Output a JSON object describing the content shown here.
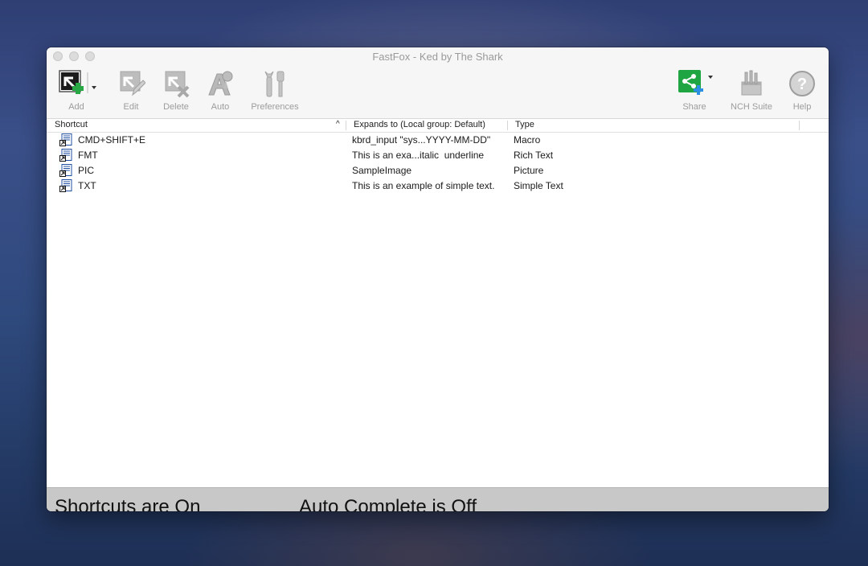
{
  "window": {
    "title": "FastFox - Ked by The Shark"
  },
  "toolbar": {
    "add": "Add",
    "edit": "Edit",
    "delete": "Delete",
    "auto": "Auto",
    "preferences": "Preferences",
    "share": "Share",
    "nch_suite": "NCH Suite",
    "help": "Help"
  },
  "table": {
    "columns": [
      "Shortcut",
      "Expands to (Local group: Default)",
      "Type"
    ],
    "rows": [
      {
        "shortcut": "CMD+SHIFT+E",
        "expands": "kbrd_input \"sys...YYYY-MM-DD\"",
        "type": "Macro"
      },
      {
        "shortcut": "FMT",
        "expands": "This is an exa...italic  underline",
        "type": "Rich Text"
      },
      {
        "shortcut": "PIC",
        "expands": "SampleImage",
        "type": "Picture"
      },
      {
        "shortcut": "TXT",
        "expands": "This is an example of simple text.",
        "type": "Simple Text"
      }
    ]
  },
  "status": {
    "shortcuts": "Shortcuts are On",
    "autocomplete": "Auto Complete is Off"
  },
  "colors": {
    "accent_green": "#1fa541",
    "status_bar": "#c8c8c8"
  },
  "icons": [
    "add-shortcut-icon",
    "edit-icon",
    "delete-icon",
    "auto-icon",
    "preferences-icon",
    "share-icon",
    "nch-suite-icon",
    "help-icon",
    "shortcut-file-icon"
  ]
}
